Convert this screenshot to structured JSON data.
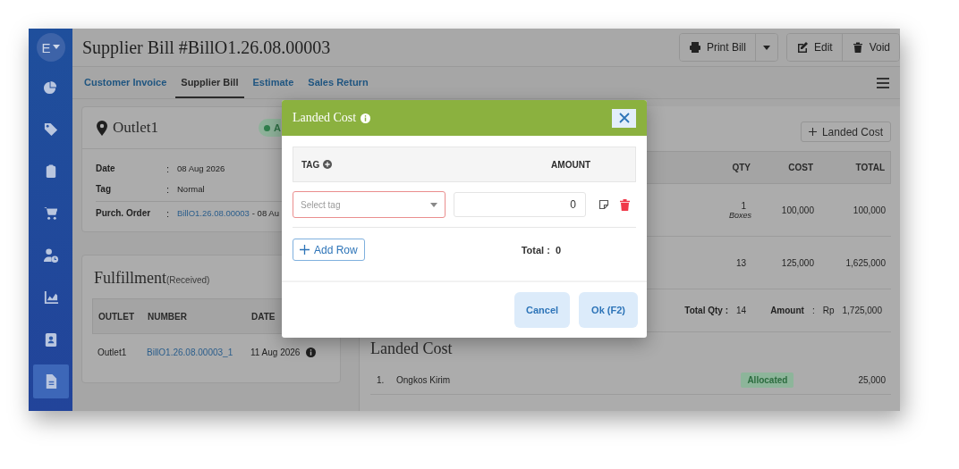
{
  "sidebar": {
    "avatar": "E",
    "items": [
      {
        "selected": false
      },
      {
        "selected": false
      },
      {
        "selected": false
      },
      {
        "selected": false
      },
      {
        "selected": false
      },
      {
        "selected": false
      },
      {
        "selected": false
      },
      {
        "selected": true
      }
    ]
  },
  "header": {
    "title": "Supplier Bill #BillO1.26.08.00003",
    "buttons": [
      {
        "kind": "print",
        "label": "Print Bill"
      },
      {
        "kind": "caret"
      },
      {
        "kind": "edit",
        "label": "Edit"
      },
      {
        "kind": "void",
        "label": "Void"
      }
    ]
  },
  "tabs": [
    {
      "label": "Customer Invoice",
      "selected": false
    },
    {
      "label": "Supplier Bill",
      "selected": true
    },
    {
      "label": "Estimate",
      "selected": false
    },
    {
      "label": "Sales Return",
      "selected": false
    }
  ],
  "bill_card": {
    "outlet": "Outlet1",
    "status": "A",
    "fields": [
      {
        "label": "Date",
        "sep": ":",
        "value": "08 Aug 2026"
      },
      {
        "label": "Tag",
        "sep": ":",
        "value": "Normal"
      },
      {
        "label": "Purch. Order",
        "sep": ":",
        "link": "BillO1.26.08.00003",
        "value": "- 08 Au"
      }
    ]
  },
  "fulfillment": {
    "title": "Fulfillment",
    "subtitle": "(Received)",
    "columns": [
      "OUTLET",
      "NUMBER",
      "DATE"
    ],
    "rows": [
      {
        "outlet": "Outlet1",
        "number": "BillO1.26.08.00003_1",
        "date": "11 Aug 2026"
      }
    ]
  },
  "items_panel": {
    "button": "Landed Cost",
    "columns": [
      "QTY",
      "COST",
      "TOTAL"
    ],
    "rows": [
      {
        "qty": "1",
        "unit": "Boxes",
        "cost": "100,000",
        "total": "100,000"
      },
      {
        "qty": "13",
        "cost": "125,000",
        "total": "1,625,000"
      }
    ],
    "summary": {
      "qty_label": "Total Qty :",
      "qty": "14",
      "amount_label": "Amount",
      "sep": ":",
      "currency": "Rp",
      "amount": "1,725,000"
    }
  },
  "landed_cost": {
    "title": "Landed Cost",
    "rows": [
      {
        "index": "1.",
        "name": "Ongkos Kirim",
        "status": "Allocated",
        "amount": "25,000"
      }
    ]
  },
  "modal": {
    "title": "Landed Cost",
    "columns": [
      "TAG",
      "AMOUNT"
    ],
    "rows": [
      {
        "placeholder": "Select tag",
        "amount": "0",
        "invalid": true
      }
    ],
    "add_row": "Add Row",
    "total_label": "Total :",
    "total": "0",
    "buttons": [
      "Cancel",
      "Ok (F2)"
    ]
  }
}
